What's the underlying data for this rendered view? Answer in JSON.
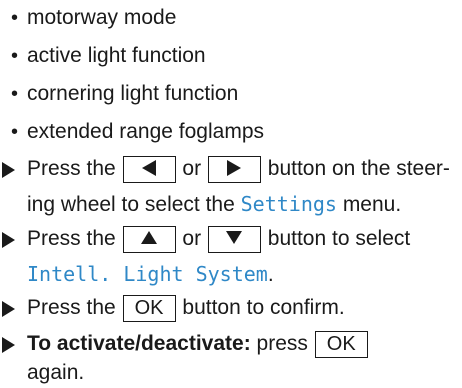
{
  "bullets": [
    "motorway mode",
    "active light function",
    "cornering light function",
    "extended range foglamps"
  ],
  "bullet_char": "•",
  "icons": {
    "step_arrow": "right-triangle-arrow",
    "left_button": "left-triangle-icon",
    "right_button": "right-triangle-icon",
    "up_button": "up-triangle-icon",
    "down_button": "down-triangle-icon"
  },
  "display_color": "#2f88c7",
  "steps": {
    "s1": {
      "press_the": "Press the",
      "or": "or",
      "button_on_the_steer": "button on the steer-",
      "line2_a": "ing wheel to select the",
      "settings": "Settings",
      "menu": "menu."
    },
    "s2": {
      "press_the": "Press the",
      "or": "or",
      "button_to_select": "button to select",
      "menu_item": "Intell. Light System",
      "period": "."
    },
    "s3": {
      "press_the": "Press the",
      "ok": "OK",
      "button_to_confirm": "button to confirm."
    },
    "s4": {
      "bold_label": "To activate/deactivate:",
      "press": "press",
      "ok": "OK",
      "again": "again."
    }
  }
}
